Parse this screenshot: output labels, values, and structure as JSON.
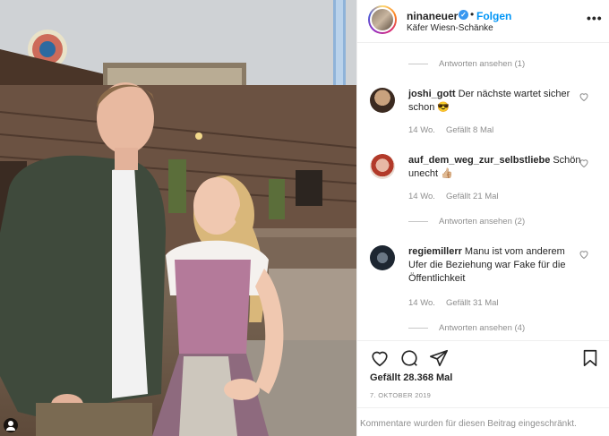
{
  "post": {
    "username": "ninaneuer",
    "verified": true,
    "separator": "•",
    "follow_label": "Folgen",
    "location": "Käfer Wiesn-Schänke",
    "more_icon": "more-horizontal-icon"
  },
  "comments": [
    {
      "type": "replies",
      "label": "Antworten ansehen (1)"
    },
    {
      "type": "comment",
      "username": "joshi_gott",
      "text": "Der nächste wartet sicher schon 😎",
      "age": "14 Wo.",
      "likes": "Gefällt 8 Mal"
    },
    {
      "type": "comment",
      "username": "auf_dem_weg_zur_selbstliebe",
      "text": "Schön unecht 👍🏼",
      "age": "14 Wo.",
      "likes": "Gefällt 21 Mal"
    },
    {
      "type": "replies",
      "label": "Antworten ansehen (2)"
    },
    {
      "type": "comment",
      "username": "regiemillerr",
      "text": "Manu ist vom anderem Ufer die Beziehung war Fake für die Öffentlichkeit",
      "age": "14 Wo.",
      "likes": "Gefällt 31 Mal"
    },
    {
      "type": "replies",
      "label": "Antworten ansehen (4)"
    }
  ],
  "footer": {
    "likes": "Gefällt 28.368 Mal",
    "date": "7. OKTOBER 2019",
    "comments_disabled": "Kommentare wurden für diesen Beitrag eingeschränkt."
  },
  "colors": {
    "accent": "#0095f6",
    "verified": "#3897f0",
    "muted": "#8e8e8e",
    "text": "#262626"
  }
}
